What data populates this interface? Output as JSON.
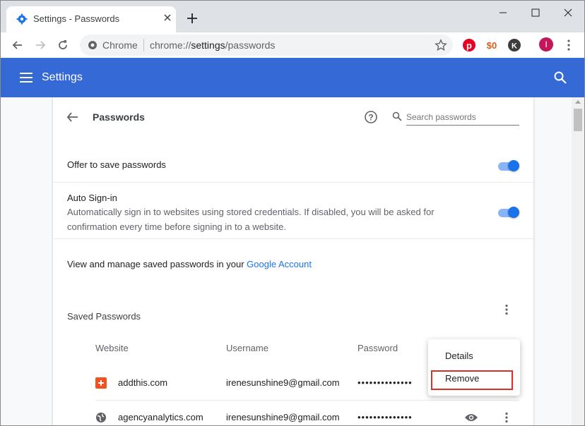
{
  "window": {
    "tab_title": "Settings - Passwords",
    "new_tab_icon": "plus-icon",
    "controls": [
      "minimize-icon",
      "maximize-icon",
      "close-icon"
    ]
  },
  "toolbar": {
    "omnibox_label": "Chrome",
    "url_prefix": "chrome://",
    "url_host": "settings",
    "url_path": "/passwords",
    "extensions": [
      "pinterest-icon",
      "honey-icon",
      "k-extension-icon"
    ],
    "avatar_letter": "I",
    "colors": {
      "avatar": "#c2185b"
    }
  },
  "header": {
    "title": "Settings",
    "colors": {
      "background": "#3569d5"
    }
  },
  "passwords": {
    "title": "Passwords",
    "search_placeholder": "Search passwords",
    "offer_to_save": {
      "label": "Offer to save passwords",
      "enabled": true
    },
    "auto_signin": {
      "label": "Auto Sign-in",
      "description": "Automatically sign in to websites using stored credentials. If disabled, you will be asked for confirmation every time before signing in to a website.",
      "enabled": true
    },
    "manage_text": "View and manage saved passwords in your ",
    "manage_link": "Google Account",
    "saved_title": "Saved Passwords",
    "columns": {
      "website": "Website",
      "username": "Username",
      "password": "Password"
    },
    "rows": [
      {
        "site": "addthis.com",
        "username": "irenesunshine9@gmail.com",
        "password": "••••••••••••••",
        "icon": "addthis-icon"
      },
      {
        "site": "agencyanalytics.com",
        "username": "irenesunshine9@gmail.com",
        "password": "••••••••••••••",
        "icon": "globe-icon"
      }
    ]
  },
  "popup_menu": {
    "items": [
      "Details",
      "Remove"
    ],
    "highlighted": "Remove",
    "colors": {
      "highlight_border": "#d93025"
    }
  }
}
